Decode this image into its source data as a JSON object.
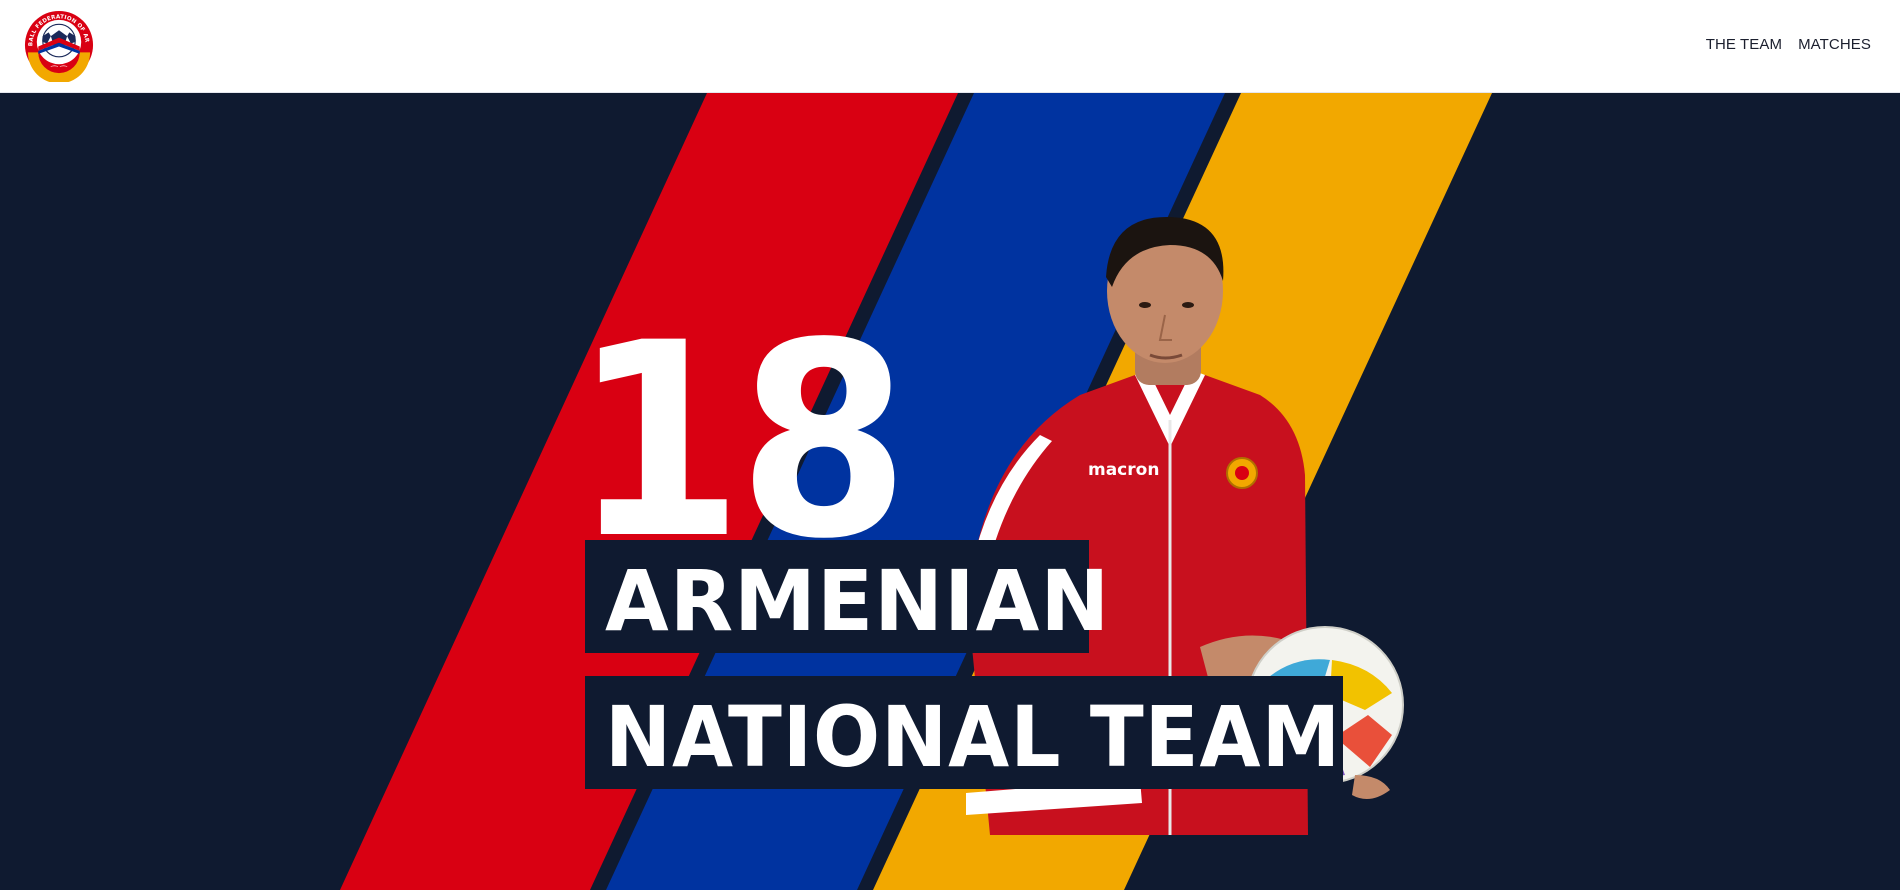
{
  "header": {
    "logo_alt": "Football Federation of Armenia",
    "logo_text": "FOOTBALL FEDERATION OF ARMENIA",
    "nav": [
      {
        "label": "THE TEAM"
      },
      {
        "label": "MATCHES"
      }
    ]
  },
  "hero": {
    "number": "18",
    "title_line1": "ARMENIAN",
    "title_line2": "NATIONAL TEAM",
    "jersey_brand": "macron",
    "colors": {
      "background": "#0f1a30",
      "red": "#d90012",
      "blue": "#0033a0",
      "orange": "#f2a800"
    }
  }
}
